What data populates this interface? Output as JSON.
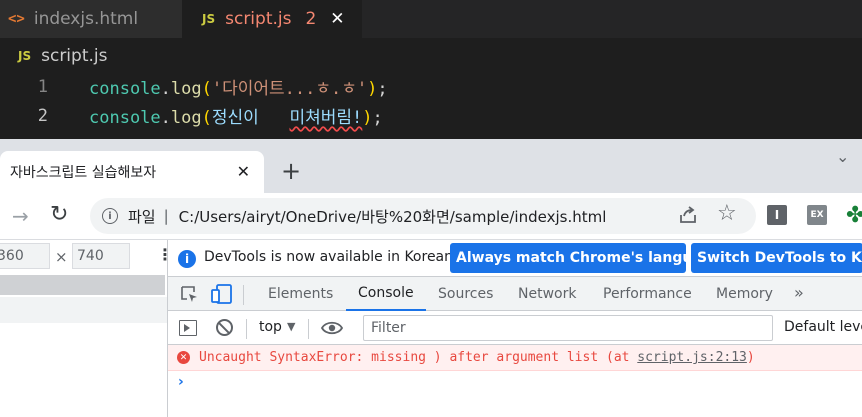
{
  "editor": {
    "tabs": [
      {
        "icon": "<>",
        "label": "indexjs.html"
      },
      {
        "icon": "JS",
        "label": "script.js",
        "problem_count": "2",
        "close": "✕"
      }
    ],
    "breadcrumb": {
      "icon": "JS",
      "label": "script.js"
    },
    "lines": [
      {
        "number": "1",
        "tokens": {
          "obj": "console",
          "dot": ".",
          "fn": "log",
          "open": "(",
          "str": "'다이어트...ㅎ.ㅎ'",
          "close": ")",
          "semi": ";"
        }
      },
      {
        "number": "2",
        "tokens": {
          "obj": "console",
          "dot": ".",
          "fn": "log",
          "open": "(",
          "ident": "정신이   ",
          "err": "미쳐버림!",
          "close": ")",
          "semi": ";"
        }
      }
    ]
  },
  "browser": {
    "tab_title": "자바스크립트 실습해보자",
    "tab_close": "✕",
    "new_tab": "+",
    "tabstrip_menu": "⌄",
    "omnibox": {
      "label": "파일",
      "separator": "|",
      "url": "C:/Users/airyt/OneDrive/바탕%20화면/sample/indexjs.html"
    },
    "extensions": [
      {
        "label": "I"
      },
      {
        "label": "EX"
      }
    ]
  },
  "device_toolbar": {
    "width": "360",
    "times": "×",
    "height": "740",
    "more": "⋮"
  },
  "devtools": {
    "infobar": {
      "text": "DevTools is now available in Korean!",
      "button_match": "Always match Chrome's language",
      "button_switch": "Switch DevTools to Korean"
    },
    "tabs": [
      "Elements",
      "Console",
      "Sources",
      "Network",
      "Performance",
      "Memory"
    ],
    "selected_tab": "Console",
    "more_tabs": "»",
    "console_toolbar": {
      "context": "top",
      "filter_placeholder": "Filter",
      "levels": "Default levels"
    },
    "console": {
      "error_message": "Uncaught SyntaxError: missing ) after argument list (at ",
      "error_link": "script.js:2:13",
      "error_suffix": ")",
      "prompt": "›"
    }
  }
}
